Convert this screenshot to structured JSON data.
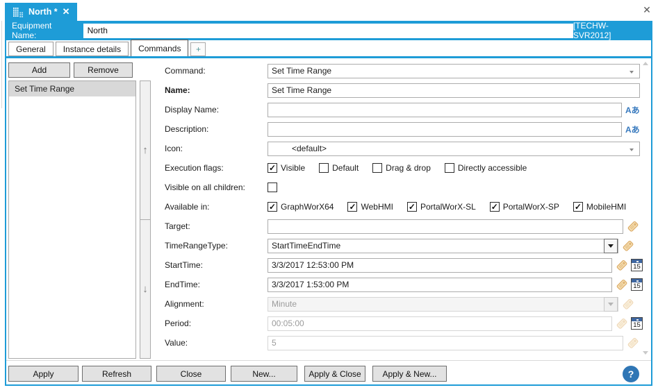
{
  "window": {
    "app_close_glyph": "✕"
  },
  "doc_tab": {
    "title": "North *",
    "close_glyph": "✕"
  },
  "equipment_bar": {
    "label": "Equipment Name:",
    "value": "North",
    "server": "[TECHW-SVR2012]"
  },
  "tab_strip": {
    "tabs": [
      {
        "label": "General",
        "active": false
      },
      {
        "label": "Instance details",
        "active": false
      },
      {
        "label": "Commands",
        "active": true
      }
    ],
    "add_tab_glyph": "+"
  },
  "left_panel": {
    "add_button": "Add",
    "remove_button": "Remove",
    "commands": [
      {
        "label": "Set Time Range",
        "selected": true
      }
    ]
  },
  "reorder": {
    "up_glyph": "↑",
    "down_glyph": "↓"
  },
  "glyphs": {
    "check": "✓",
    "lang": "Aあ",
    "calendar_day": "15",
    "help": "?"
  },
  "form": {
    "rows": [
      {
        "id": "command",
        "label": "Command:",
        "type": "combo",
        "value": "Set Time Range",
        "icons": []
      },
      {
        "id": "name",
        "label": "Name:",
        "bold": true,
        "type": "input",
        "value": "Set Time Range",
        "icons": []
      },
      {
        "id": "display-name",
        "label": "Display Name:",
        "type": "input",
        "value": "",
        "icons": [
          "lang"
        ]
      },
      {
        "id": "description",
        "label": "Description:",
        "type": "input",
        "value": "",
        "icons": [
          "lang"
        ]
      },
      {
        "id": "icon",
        "label": "Icon:",
        "type": "combo",
        "value": "<default>",
        "indent": true,
        "icons": []
      },
      {
        "id": "execution-flags",
        "label": "Execution flags:",
        "type": "checks",
        "checks": [
          {
            "id": "visible",
            "label": "Visible",
            "checked": true
          },
          {
            "id": "default",
            "label": "Default",
            "checked": false
          },
          {
            "id": "drag-drop",
            "label": "Drag & drop",
            "checked": false
          },
          {
            "id": "directly-accessible",
            "label": "Directly accessible",
            "checked": false
          }
        ]
      },
      {
        "id": "visible-on-all-children",
        "label": "Visible on all children:",
        "type": "checks",
        "checks": [
          {
            "id": "visible-on-all-children",
            "label": "",
            "checked": false
          }
        ]
      },
      {
        "id": "available-in",
        "label": "Available in:",
        "type": "checks",
        "checks": [
          {
            "id": "graphworx64",
            "label": "GraphWorX64",
            "checked": true
          },
          {
            "id": "webhmi",
            "label": "WebHMI",
            "checked": true
          },
          {
            "id": "portalworx-sl",
            "label": "PortalWorX-SL",
            "checked": true
          },
          {
            "id": "portalworx-sp",
            "label": "PortalWorX-SP",
            "checked": true
          },
          {
            "id": "mobilehmi",
            "label": "MobileHMI",
            "checked": true
          }
        ]
      },
      {
        "id": "target",
        "label": "Target:",
        "type": "input",
        "value": "",
        "icons": [
          "tag"
        ]
      },
      {
        "id": "time-range-type",
        "label": "TimeRangeType:",
        "type": "combo2",
        "value": "StartTimeEndTime",
        "icons": [
          "tag"
        ]
      },
      {
        "id": "start-time",
        "label": "StartTime:",
        "type": "input",
        "value": "3/3/2017 12:53:00 PM",
        "icons": [
          "tag",
          "calendar"
        ]
      },
      {
        "id": "end-time",
        "label": "EndTime:",
        "type": "input",
        "value": "3/3/2017 1:53:00 PM",
        "icons": [
          "tag",
          "calendar"
        ]
      },
      {
        "id": "alignment",
        "label": "Alignment:",
        "type": "combo2",
        "value": "Minute",
        "disabled": true,
        "icons": [
          "tag"
        ]
      },
      {
        "id": "period",
        "label": "Period:",
        "type": "input",
        "value": "00:05:00",
        "disabled": true,
        "icons": [
          "tag",
          "calendar"
        ]
      },
      {
        "id": "value",
        "label": "Value:",
        "type": "input",
        "value": "5",
        "disabled": true,
        "icons": [
          "tag"
        ]
      }
    ]
  },
  "footer": {
    "buttons": [
      {
        "id": "apply",
        "label": "Apply"
      },
      {
        "id": "refresh",
        "label": "Refresh"
      },
      {
        "id": "close",
        "label": "Close"
      },
      {
        "id": "new",
        "label": "New..."
      },
      {
        "id": "apply-close",
        "label": "Apply & Close"
      },
      {
        "id": "apply-new",
        "label": "Apply & New..."
      }
    ]
  }
}
